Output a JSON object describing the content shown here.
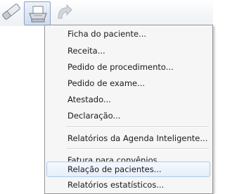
{
  "toolbar": {
    "buttons": [
      {
        "icon": "eraser-icon"
      },
      {
        "icon": "printer-icon"
      },
      {
        "icon": "forward-arrow-icon"
      }
    ]
  },
  "menu": {
    "items": [
      {
        "label": "Ficha do paciente..."
      },
      {
        "label": "Receita..."
      },
      {
        "label": "Pedido de procedimento..."
      },
      {
        "label": "Pedido de exame..."
      },
      {
        "label": "Atestado..."
      },
      {
        "label": "Declaração..."
      },
      {
        "label": "Relatórios da Agenda Inteligente..."
      },
      {
        "label": "Fatura para convênios..."
      },
      {
        "label": "Relação de pacientes...",
        "highlighted": true
      },
      {
        "label": "Relatórios estatísticos..."
      }
    ]
  }
}
